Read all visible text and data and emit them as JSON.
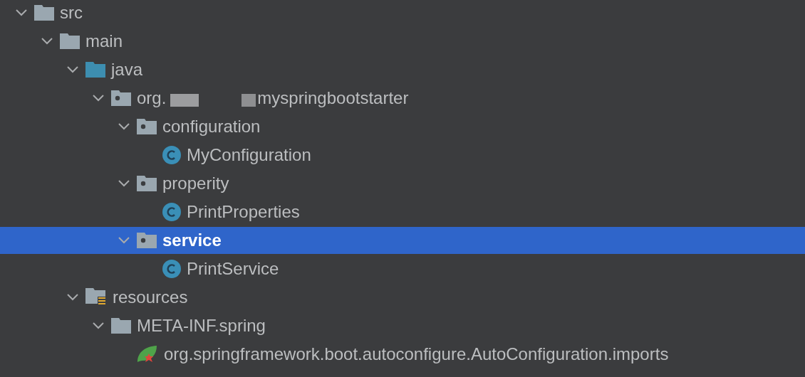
{
  "tree": [
    {
      "kind": "folder",
      "name": "src",
      "expanded": true,
      "selected": false,
      "children": [
        {
          "kind": "folder",
          "name": "main",
          "expanded": true,
          "selected": false,
          "children": [
            {
              "kind": "source-folder",
              "name": "java",
              "expanded": true,
              "selected": false,
              "children": [
                {
                  "kind": "package",
                  "name": "org.",
                  "redacted": true,
                  "name_suffix": "myspringbootstarter",
                  "expanded": true,
                  "selected": false,
                  "children": [
                    {
                      "kind": "package",
                      "name": "configuration",
                      "expanded": true,
                      "selected": false,
                      "children": [
                        {
                          "kind": "class",
                          "name": "MyConfiguration",
                          "selected": false
                        }
                      ]
                    },
                    {
                      "kind": "package",
                      "name": "properity",
                      "expanded": true,
                      "selected": false,
                      "children": [
                        {
                          "kind": "class",
                          "name": "PrintProperties",
                          "selected": false
                        }
                      ]
                    },
                    {
                      "kind": "package",
                      "name": "service",
                      "expanded": true,
                      "selected": true,
                      "children": [
                        {
                          "kind": "class",
                          "name": "PrintService",
                          "selected": false
                        }
                      ]
                    }
                  ]
                }
              ]
            },
            {
              "kind": "resources",
              "name": "resources",
              "expanded": true,
              "selected": false,
              "children": [
                {
                  "kind": "folder",
                  "name": "META-INF.spring",
                  "expanded": true,
                  "selected": false,
                  "children": [
                    {
                      "kind": "spring-file",
                      "name": "org.springframework.boot.autoconfigure.AutoConfiguration.imports",
                      "selected": false
                    }
                  ]
                }
              ]
            }
          ]
        }
      ]
    }
  ]
}
